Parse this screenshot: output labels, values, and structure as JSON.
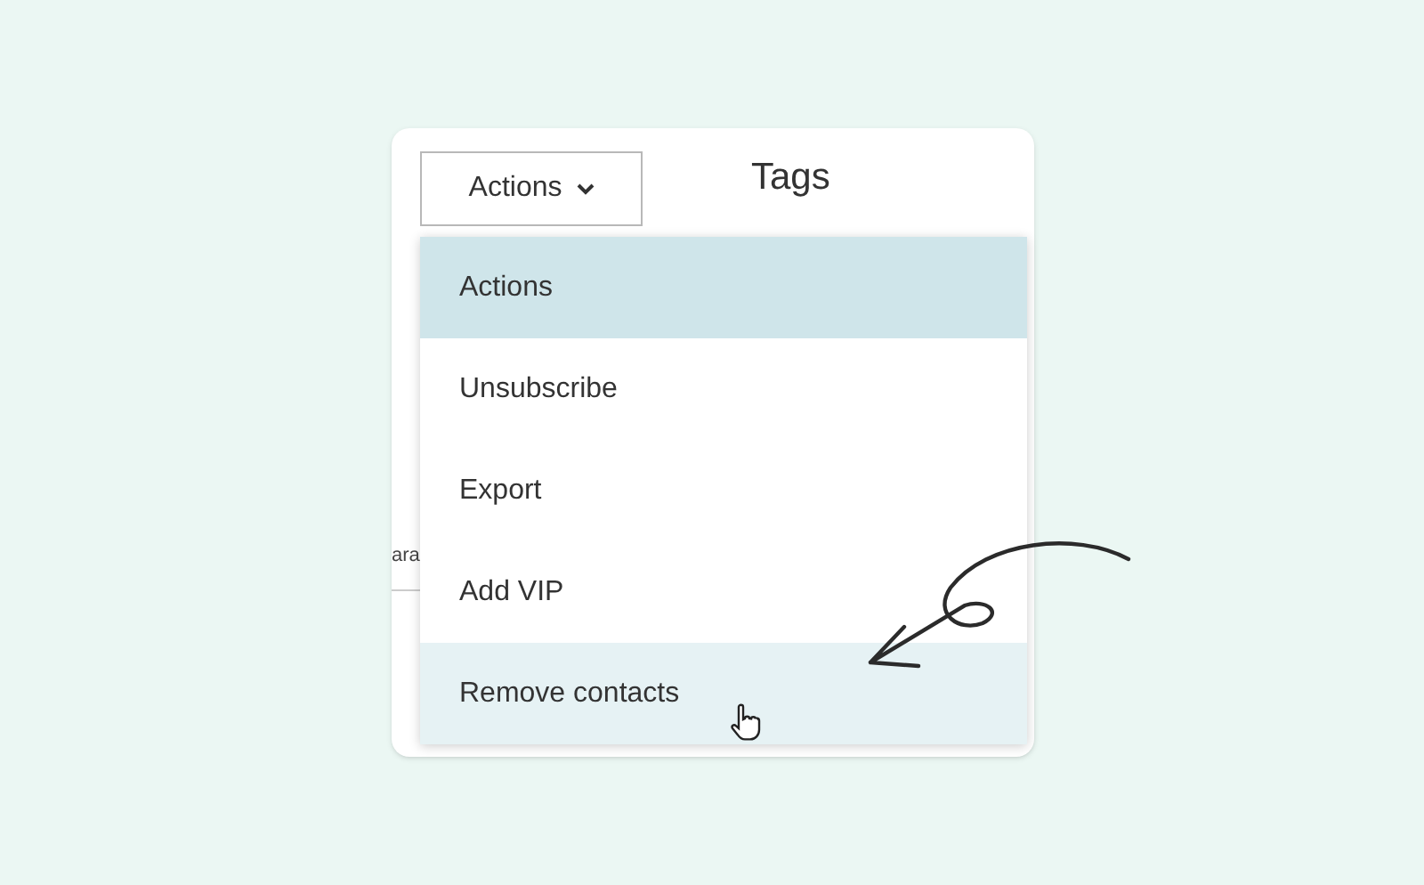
{
  "actions_button": {
    "label": "Actions"
  },
  "heading": "Tags",
  "background_text": "ara",
  "menu": [
    {
      "label": "Actions",
      "selected": true,
      "hovered": false
    },
    {
      "label": "Unsubscribe",
      "selected": false,
      "hovered": false
    },
    {
      "label": "Export",
      "selected": false,
      "hovered": false
    },
    {
      "label": "Add VIP",
      "selected": false,
      "hovered": false
    },
    {
      "label": "Remove contacts",
      "selected": false,
      "hovered": true
    }
  ]
}
